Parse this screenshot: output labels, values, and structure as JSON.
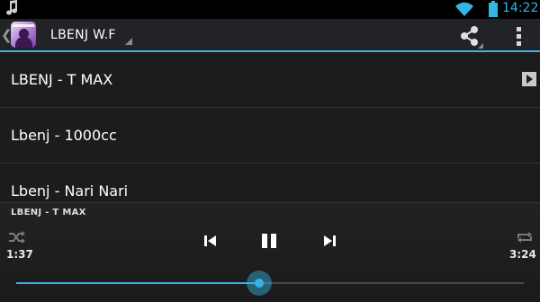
{
  "status_bar": {
    "time": "14:22",
    "icons": [
      "music-note-icon",
      "wifi-icon",
      "battery-icon"
    ],
    "accent_color": "#33b5e5"
  },
  "action_bar": {
    "title": "LBENJ W.F",
    "icons": [
      "up-caret-icon",
      "app-logo",
      "share-icon",
      "overflow-menu-icon"
    ]
  },
  "songs": [
    {
      "title": "LBENJ - T MAX",
      "now_playing": true
    },
    {
      "title": "Lbenj - 1000cc",
      "now_playing": false
    },
    {
      "title": "Lbenj - Nari Nari",
      "now_playing": false
    }
  ],
  "player": {
    "now_playing_title": "LBENJ - T MAX",
    "elapsed": "1:37",
    "duration": "3:24",
    "progress": 0.478,
    "controls": [
      "shuffle-icon",
      "previous-icon",
      "pause-icon",
      "next-icon",
      "repeat-icon"
    ]
  }
}
